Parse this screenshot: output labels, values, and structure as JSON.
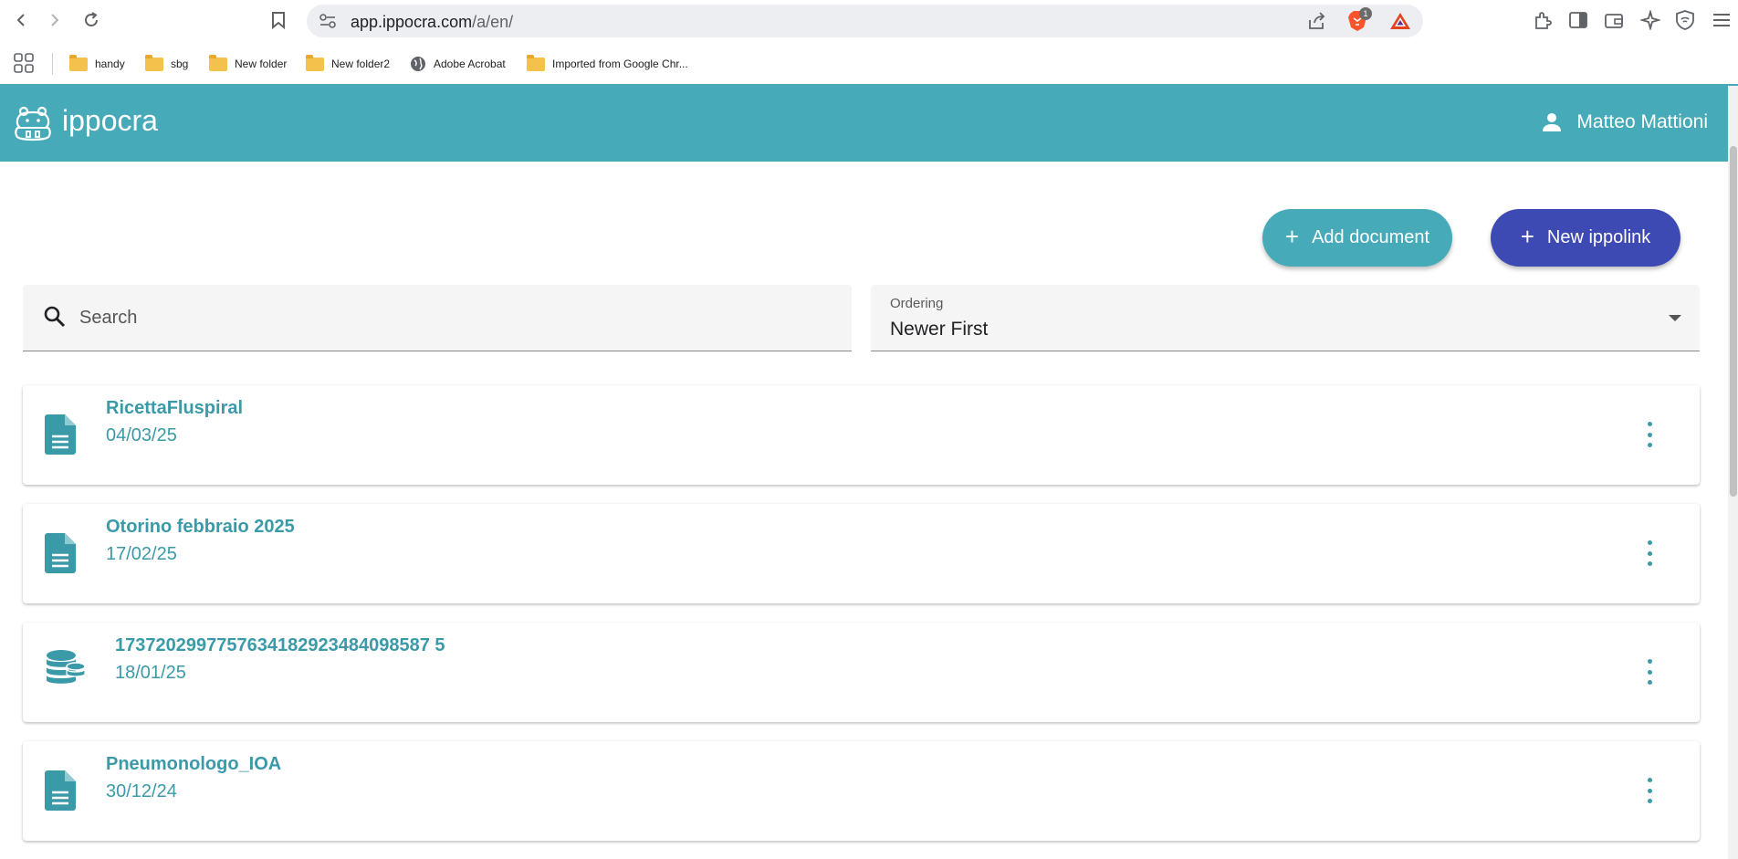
{
  "browser": {
    "url_host": "app.ippocra.com",
    "url_path": "/a/en/",
    "brave_badge": "1",
    "bookmarks": [
      {
        "label": "handy",
        "icon": "folder-icon"
      },
      {
        "label": "sbg",
        "icon": "folder-icon"
      },
      {
        "label": "New folder",
        "icon": "folder-icon"
      },
      {
        "label": "New folder2",
        "icon": "folder-icon"
      },
      {
        "label": "Adobe Acrobat",
        "icon": "globe-icon"
      },
      {
        "label": "Imported from Google Chr...",
        "icon": "folder-icon"
      }
    ]
  },
  "header": {
    "app_name": "ippocra",
    "user_name": "Matteo Mattioni",
    "color": "#46aab8"
  },
  "actions": {
    "add_document": "Add document",
    "new_ippolink": "New ippolink",
    "add_color": "#46aab8",
    "new_color": "#3e4ab3"
  },
  "search": {
    "placeholder": "Search"
  },
  "ordering": {
    "label": "Ordering",
    "value": "Newer First"
  },
  "documents": [
    {
      "title": "RicettaFluspiral",
      "date": "04/03/25",
      "icon": "document-icon"
    },
    {
      "title": "Otorino febbraio 2025",
      "date": "17/02/25",
      "icon": "document-icon"
    },
    {
      "title": "1737202997757634182923484098587 5",
      "date": "18/01/25",
      "icon": "database-icon"
    },
    {
      "title": "Pneumonologo_IOA",
      "date": "30/12/24",
      "icon": "document-icon"
    }
  ]
}
